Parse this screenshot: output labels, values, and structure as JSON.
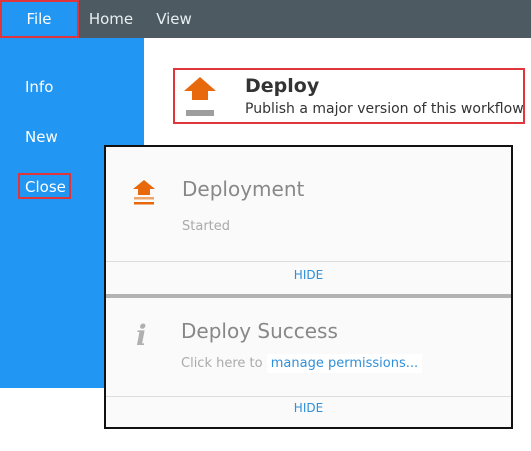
{
  "ribbon": {
    "tabs": [
      {
        "label": "File"
      },
      {
        "label": "Home"
      },
      {
        "label": "View"
      }
    ]
  },
  "sidebar": {
    "items": [
      {
        "label": "Info"
      },
      {
        "label": "New"
      },
      {
        "label": "Close"
      }
    ]
  },
  "deploy_command": {
    "title": "Deploy",
    "description": "Publish a major version of this workflow",
    "icon": "deploy-upload-icon"
  },
  "notifications": [
    {
      "title": "Deployment",
      "status": "Started",
      "action": "HIDE",
      "icon": "deploy-upload-icon"
    },
    {
      "title": "Deploy Success",
      "message_prefix": "Click here to",
      "link": "manage permissions...",
      "action": "HIDE",
      "icon": "info-icon"
    }
  ],
  "colors": {
    "accent": "#2196f3",
    "ribbon": "#4d5a62",
    "highlight": "#e0353a",
    "deploy_orange": "#e8680c",
    "link": "#2f8fd8"
  }
}
